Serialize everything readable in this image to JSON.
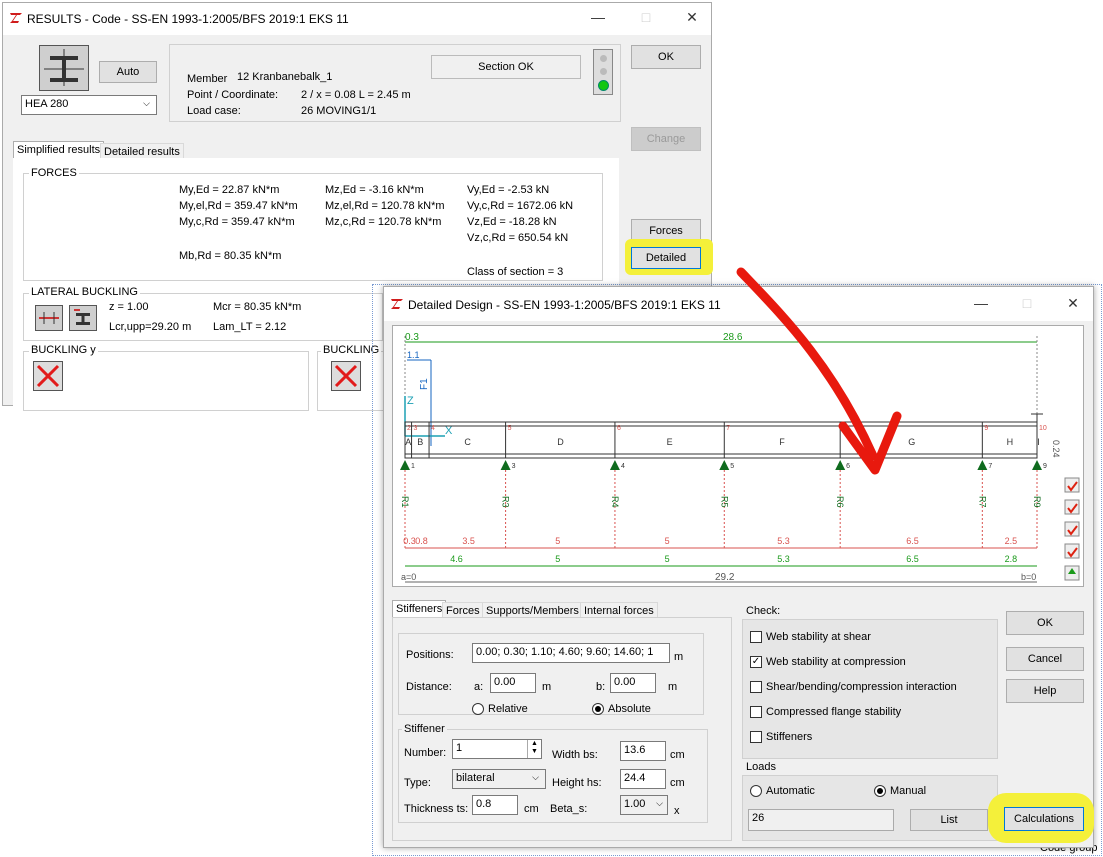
{
  "results_window": {
    "title": "RESULTS - Code - SS-EN 1993-1:2005/BFS 2019:1 EKS 11",
    "auto_label": "Auto",
    "section_select": "HEA 280",
    "member_label": "Member",
    "member_value": "12  Kranbanebalk_1",
    "point_label": "Point / Coordinate:",
    "point_value": "2 / x = 0.08 L = 2.45 m",
    "loadcase_label": "Load case:",
    "loadcase_value": "26 MOVING1/1",
    "section_status": "Section OK",
    "ok_label": "OK",
    "change_label": "Change",
    "forces_label": "Forces",
    "detailed_label": "Detailed",
    "tabs": [
      "Simplified results",
      "Detailed results"
    ],
    "forces_group": "FORCES",
    "forces": {
      "c1": [
        "My,Ed = 22.87 kN*m",
        "My,el,Rd = 359.47 kN*m",
        "My,c,Rd = 359.47 kN*m"
      ],
      "c2": [
        "Mz,Ed = -3.16 kN*m",
        "Mz,el,Rd = 120.78 kN*m",
        "Mz,c,Rd = 120.78 kN*m"
      ],
      "c3": [
        "Vy,Ed = -2.53 kN",
        "Vy,c,Rd = 1672.06 kN",
        "Vz,Ed = -18.28 kN",
        "Vz,c,Rd = 650.54 kN"
      ],
      "mb": "Mb,Rd = 80.35 kN*m",
      "class": "Class of section = 3"
    },
    "lateral_group": "LATERAL BUCKLING",
    "lateral": {
      "z": "z = 1.00",
      "lcr": "Lcr,upp=29.20 m",
      "mcr": "Mcr = 80.35 kN*m",
      "lam": "Lam_LT = 2.12"
    },
    "buckling_y": "BUCKLING y",
    "buckling_z": "BUCKLING"
  },
  "detailed_window": {
    "title": "Detailed Design - SS-EN 1993-1:2005/BFS 2019:1 EKS 11",
    "diagram": {
      "total_top": "28.6",
      "offset_top": "0.3",
      "offset_1": "1.1",
      "load": "F1",
      "height": "0.24",
      "segments": [
        "A",
        "B",
        "C",
        "D",
        "E",
        "F",
        "G",
        "H",
        "I"
      ],
      "supports": [
        "R1",
        "R3",
        "R4",
        "R5",
        "R6",
        "R7",
        "R9"
      ],
      "support_nums": [
        "1",
        "3",
        "4",
        "5",
        "6",
        "7",
        "9"
      ],
      "stiff_nums": [
        "2",
        "3",
        "4",
        "5",
        "6",
        "7",
        "8",
        "9",
        "10"
      ],
      "row1": [
        "0.3",
        "0.8",
        "3.5",
        "5",
        "5",
        "5.3",
        "6.5",
        "2.5",
        "0.3"
      ],
      "row2": [
        "4.6",
        "5",
        "5",
        "5.3",
        "6.5",
        "2.8"
      ],
      "total": "29.2",
      "a_label": "a=0",
      "b_label": "b=0"
    },
    "tabs": [
      "Stiffeners",
      "Forces",
      "Supports/Members",
      "Internal forces"
    ],
    "positions_label": "Positions:",
    "positions_value": "0.00; 0.30; 1.10; 4.60; 9.60; 14.60; 1",
    "unit_m": "m",
    "distance_label": "Distance:",
    "a_label": "a:",
    "a_value": "0.00",
    "b_label": "b:",
    "b_value": "0.00",
    "relative_label": "Relative",
    "absolute_label": "Absolute",
    "stiffener_group": "Stiffener",
    "number_label": "Number:",
    "number_value": "1",
    "width_label": "Width bs:",
    "width_value": "13.6",
    "unit_cm": "cm",
    "type_label": "Type:",
    "type_value": "bilateral",
    "height_label": "Height hs:",
    "height_value": "24.4",
    "thickness_label": "Thickness ts:",
    "thickness_value": "0.8",
    "beta_label": "Beta_s:",
    "beta_value": "1.00",
    "beta_unit": "x",
    "check_label": "Check:",
    "checks": [
      {
        "label": "Web stability at shear",
        "checked": false
      },
      {
        "label": "Web stability at compression",
        "checked": true
      },
      {
        "label": "Shear/bending/compression interaction",
        "checked": false
      },
      {
        "label": "Compressed flange stability",
        "checked": false
      },
      {
        "label": "Stiffeners",
        "checked": false
      }
    ],
    "loads_label": "Loads",
    "automatic_label": "Automatic",
    "manual_label": "Manual",
    "loads_value": "26",
    "list_label": "List",
    "ok_label": "OK",
    "cancel_label": "Cancel",
    "help_label": "Help",
    "calculations_label": "Calculations"
  },
  "background": {
    "partial_text": "Code group"
  },
  "colors": {
    "highlight": "#f4f03a",
    "arrow": "#e8190e",
    "dim_green": "#1a9a1a",
    "support_green": "#0f6b1e",
    "red_label": "#d9534f",
    "axis_blue": "#1565c0"
  }
}
